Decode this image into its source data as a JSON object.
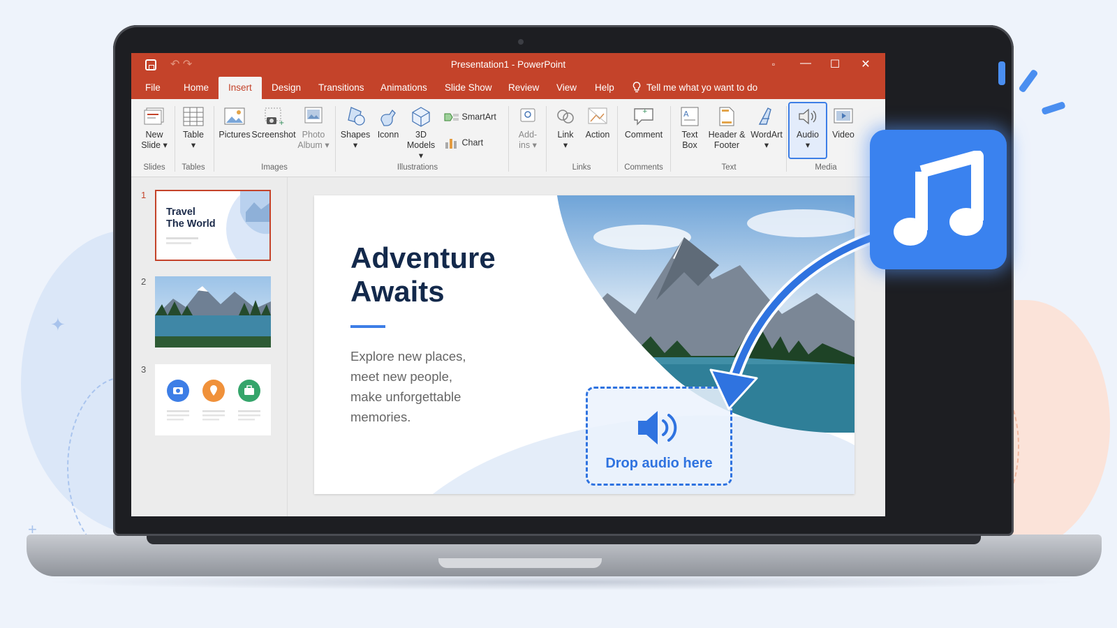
{
  "window": {
    "title": "Presentation1 - PowerPoint",
    "controls": {
      "minimize": "—",
      "maximize": "☐",
      "close": "✕"
    }
  },
  "tabs": [
    {
      "label": "File"
    },
    {
      "label": "Home"
    },
    {
      "label": "Insert",
      "active": true
    },
    {
      "label": "Design"
    },
    {
      "label": "Transitions"
    },
    {
      "label": "Animations"
    },
    {
      "label": "Slide Show"
    },
    {
      "label": "Review"
    },
    {
      "label": "View"
    },
    {
      "label": "Help"
    }
  ],
  "tell_me": "Tell me what yo want to do",
  "ribbon": {
    "slides": {
      "new_slide": "New Slide",
      "group": "Slides"
    },
    "tables": {
      "table": "Table",
      "group": "Tables"
    },
    "images": {
      "pictures": "Pictures",
      "screenshot": "Screenshot",
      "photo_album": "Photo Album",
      "group": "Images"
    },
    "illustrations": {
      "shapes": "Shapes",
      "icons": "Iconn",
      "models": "3D Models",
      "smartart": "SmartArt",
      "chart": "Chart",
      "group": "Illustrations"
    },
    "addins": {
      "label": "Add-ins"
    },
    "links": {
      "link": "Link",
      "action": "Action",
      "group": "Links"
    },
    "comments": {
      "comment": "Comment",
      "group": "Comments"
    },
    "text": {
      "text_box": "Text Box",
      "header_footer": "Header & Footer",
      "wordart": "WordArt",
      "group": "Text"
    },
    "media": {
      "audio": "Audio",
      "video": "Video",
      "group": "Media"
    }
  },
  "thumbnails": [
    {
      "number": "1",
      "title_line1": "Travel",
      "title_line2": "The World",
      "selected": true
    },
    {
      "number": "2"
    },
    {
      "number": "3"
    }
  ],
  "slide": {
    "title_line1": "Adventure",
    "title_line2": "Awaits",
    "body": [
      "Explore new places,",
      "meet new people,",
      "make unforgettable",
      "memories."
    ],
    "drop_label": "Drop audio here"
  },
  "colors": {
    "accent": "#c4432a",
    "brand_blue": "#3a82ef",
    "drop_blue": "#2f73e0"
  },
  "icons": {
    "music_tile": "music-note-icon",
    "drop": "speaker-icon"
  }
}
